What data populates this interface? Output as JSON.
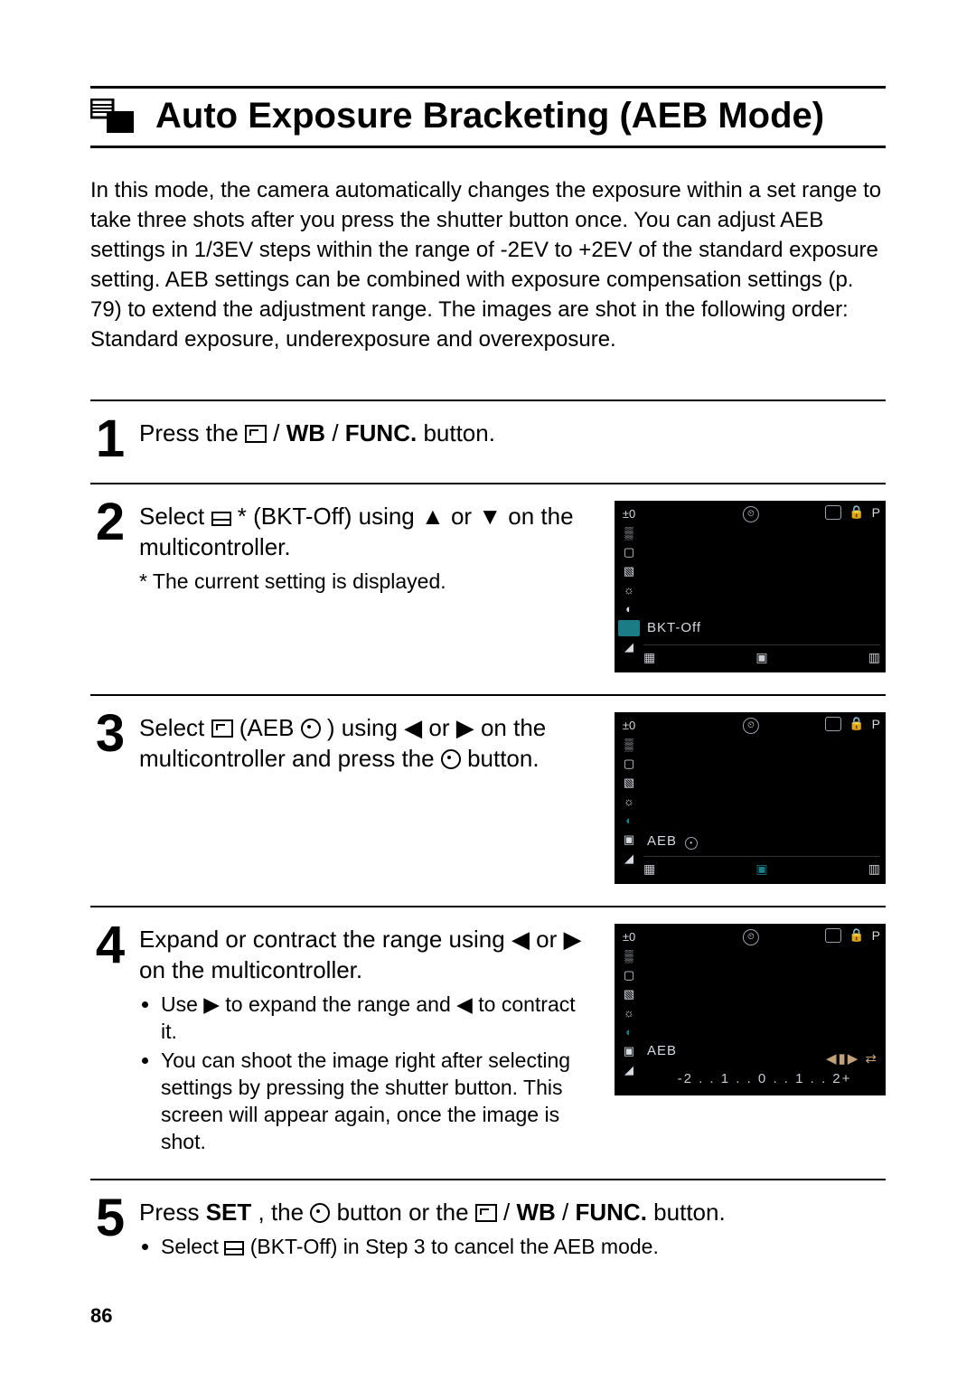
{
  "title": "Auto Exposure Bracketing (AEB Mode)",
  "intro": "In this mode, the camera automatically changes the exposure within a set range to take three shots after you press the shutter button once. You can adjust AEB settings in 1/3EV steps within the range of -2EV to +2EV of the standard exposure setting. AEB settings can be combined with exposure compensation settings (p. 79) to extend the adjustment range. The images are shot in the following order: Standard exposure, underexposure and overexposure.",
  "steps": {
    "s1": {
      "num": "1",
      "pre": "Press the ",
      "wb": "WB",
      "func": "FUNC.",
      "post": " button."
    },
    "s2": {
      "num": "2",
      "pre": "Select ",
      "mid1": "* (BKT-Off) using ",
      "up": "▲",
      "or": " or ",
      "down": "▼",
      "post": " on the multicontroller.",
      "note": "* The current setting is displayed.",
      "lcd_label": "BKT-Off",
      "lcd_overlay": "±0"
    },
    "s3": {
      "num": "3",
      "pre": "Select ",
      "abbr": " (AEB",
      "mid1": ") using ",
      "left": "◀",
      "or": " or ",
      "right": "▶",
      "mid2": " on the multicontroller and press the ",
      "post": " button.",
      "lcd_label": "AEB",
      "lcd_overlay": "±0"
    },
    "s4": {
      "num": "4",
      "pre": "Expand or contract the range using ",
      "left": "◀",
      "or": " or ",
      "right": "▶",
      "post": " on the multicontroller.",
      "b1a": "Use ",
      "b1b": " to expand the range and ",
      "b1c": " to contract it.",
      "b2": "You can shoot the image right after selecting settings by pressing the shutter button. This screen will appear again, once the image is shot.",
      "lcd_label": "AEB",
      "lcd_scale": "-2 . . 1 . . 0 . . 1 . . 2+",
      "lcd_overlay": "±0"
    },
    "s5": {
      "num": "5",
      "pre": "Press ",
      "set": "SET",
      "mid1": ", the ",
      "mid2": " button or the ",
      "wb": "WB",
      "func": "FUNC.",
      "post": " button.",
      "b1a": "Select ",
      "b1b": " (BKT-Off) in Step 3 to cancel the AEB mode."
    }
  },
  "lcd_common": {
    "left_icons": [
      "±0",
      "▒",
      "▢",
      "▧",
      "☼",
      "◐",
      "▣",
      "◢"
    ],
    "top_right_p": "P",
    "bottom_icons": [
      "▦",
      "▣",
      "▥"
    ]
  },
  "page_number": "86"
}
